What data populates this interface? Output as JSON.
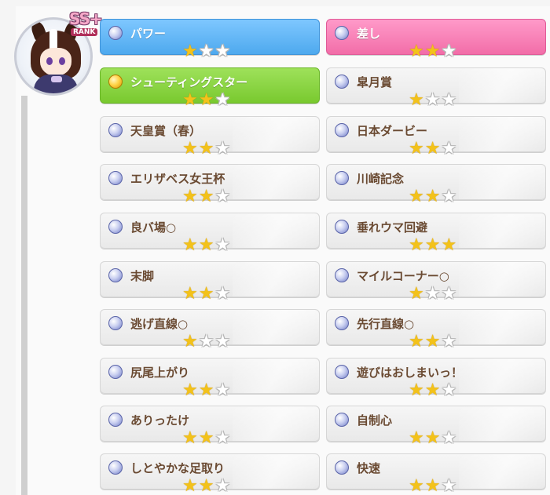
{
  "character": {
    "rank_badge": "SS+",
    "rank_text": "RANK"
  },
  "colors": {
    "blue": "#4ea9ee",
    "pink": "#f26da8",
    "green": "#79c92f",
    "gray": "#e9e9e9",
    "star_on": "#f3c21a",
    "label_brown": "#6a4a32"
  },
  "skills": [
    {
      "name": "パワー",
      "stars": 1,
      "max_stars": 3,
      "style": "blue",
      "orb": "silver"
    },
    {
      "name": "差し",
      "stars": 2,
      "max_stars": 3,
      "style": "pink",
      "orb": "silver"
    },
    {
      "name": "シューティングスター",
      "stars": 2,
      "max_stars": 3,
      "style": "green",
      "orb": "gold"
    },
    {
      "name": "皐月賞",
      "stars": 1,
      "max_stars": 3,
      "style": "gray",
      "orb": "silver"
    },
    {
      "name": "天皇賞（春）",
      "stars": 2,
      "max_stars": 3,
      "style": "gray",
      "orb": "silver"
    },
    {
      "name": "日本ダービー",
      "stars": 2,
      "max_stars": 3,
      "style": "gray",
      "orb": "silver"
    },
    {
      "name": "エリザベス女王杯",
      "stars": 2,
      "max_stars": 3,
      "style": "gray",
      "orb": "silver"
    },
    {
      "name": "川崎記念",
      "stars": 2,
      "max_stars": 3,
      "style": "gray",
      "orb": "silver"
    },
    {
      "name": "良バ場○",
      "stars": 2,
      "max_stars": 3,
      "style": "gray",
      "orb": "silver"
    },
    {
      "name": "垂れウマ回避",
      "stars": 3,
      "max_stars": 3,
      "style": "gray",
      "orb": "silver"
    },
    {
      "name": "末脚",
      "stars": 2,
      "max_stars": 3,
      "style": "gray",
      "orb": "silver"
    },
    {
      "name": "マイルコーナー○",
      "stars": 1,
      "max_stars": 3,
      "style": "gray",
      "orb": "silver"
    },
    {
      "name": "逃げ直線○",
      "stars": 1,
      "max_stars": 3,
      "style": "gray",
      "orb": "silver"
    },
    {
      "name": "先行直線○",
      "stars": 2,
      "max_stars": 3,
      "style": "gray",
      "orb": "silver"
    },
    {
      "name": "尻尾上がり",
      "stars": 2,
      "max_stars": 3,
      "style": "gray",
      "orb": "silver"
    },
    {
      "name": "遊びはおしまいっ！",
      "stars": 2,
      "max_stars": 3,
      "style": "gray",
      "orb": "silver"
    },
    {
      "name": "ありったけ",
      "stars": 2,
      "max_stars": 3,
      "style": "gray",
      "orb": "silver"
    },
    {
      "name": "自制心",
      "stars": 2,
      "max_stars": 3,
      "style": "gray",
      "orb": "silver"
    },
    {
      "name": "しとやかな足取り",
      "stars": 2,
      "max_stars": 3,
      "style": "gray",
      "orb": "silver"
    },
    {
      "name": "快速",
      "stars": 2,
      "max_stars": 3,
      "style": "gray",
      "orb": "silver"
    }
  ]
}
